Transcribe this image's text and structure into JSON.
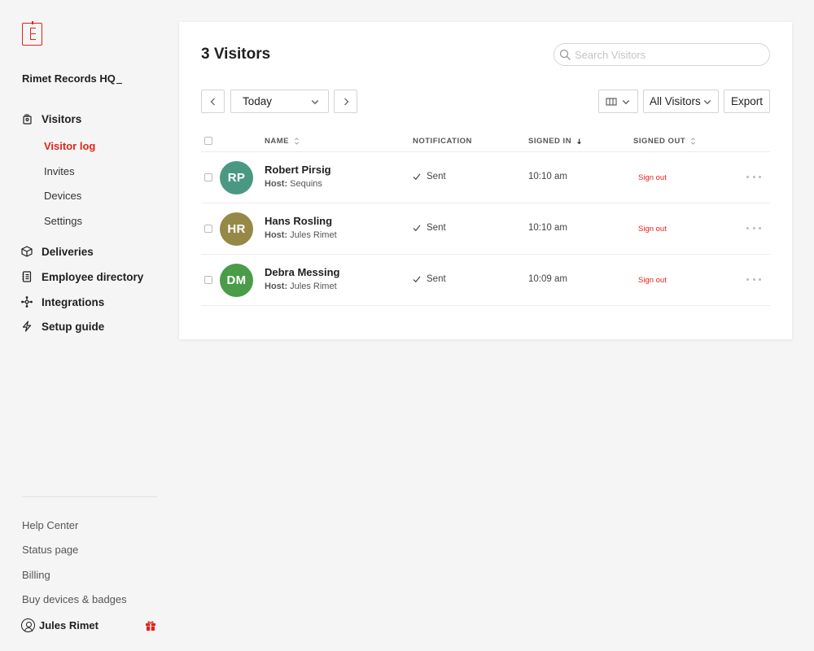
{
  "sidebar": {
    "org_name": "Rimet Records HQ",
    "nav": {
      "visitors": "Visitors",
      "visitor_log": "Visitor log",
      "invites": "Invites",
      "devices": "Devices",
      "settings": "Settings",
      "deliveries": "Deliveries",
      "employee_directory": "Employee directory",
      "integrations": "Integrations",
      "setup_guide": "Setup guide"
    },
    "footer": {
      "help_center": "Help Center",
      "status_page": "Status page",
      "billing": "Billing",
      "buy_devices": "Buy devices & badges",
      "user_name": "Jules Rimet"
    }
  },
  "header": {
    "title": "3 Visitors",
    "search_placeholder": "Search Visitors"
  },
  "toolbar": {
    "date_value": "Today",
    "filter_value": "All Visitors",
    "export_label": "Export"
  },
  "table": {
    "columns": {
      "name": "NAME",
      "notification": "NOTIFICATION",
      "signed_in": "SIGNED IN",
      "signed_out": "SIGNED OUT"
    },
    "host_label": "Host:",
    "rows": [
      {
        "initials": "RP",
        "avatar_color": "#4a9882",
        "name": "Robert Pirsig",
        "host": "Sequins",
        "notification": "Sent",
        "signed_in": "10:10 am",
        "signed_out": "Sign out"
      },
      {
        "initials": "HR",
        "avatar_color": "#968948",
        "name": "Hans Rosling",
        "host": "Jules Rimet",
        "notification": "Sent",
        "signed_in": "10:10 am",
        "signed_out": "Sign out"
      },
      {
        "initials": "DM",
        "avatar_color": "#4a9c48",
        "name": "Debra Messing",
        "host": "Jules Rimet",
        "notification": "Sent",
        "signed_in": "10:09 am",
        "signed_out": "Sign out"
      }
    ]
  },
  "colors": {
    "accent": "#e2231a",
    "background": "#f5f5f5"
  }
}
